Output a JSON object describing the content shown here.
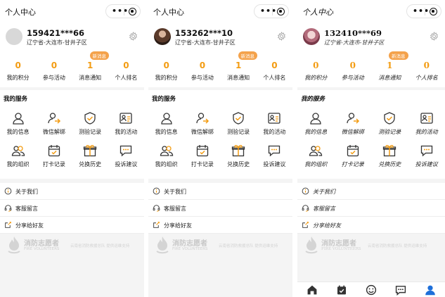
{
  "app": {
    "title": "个人中心"
  },
  "colors": {
    "accent": "#f39c12",
    "badge": "#f4a24b",
    "active_tab": "#1e6fd9"
  },
  "panels": [
    {
      "user": {
        "uid": "159421***66",
        "location": "辽宁省-大连市-甘井子区"
      },
      "stats": [
        {
          "value": "0",
          "label": "我的积分"
        },
        {
          "value": "0",
          "label": "参与活动"
        },
        {
          "value": "1",
          "label": "消息通知",
          "badge": "新消息"
        },
        {
          "value": "0",
          "label": "个人排名"
        }
      ]
    },
    {
      "user": {
        "uid": "153262***10",
        "location": "辽宁省-大连市-甘井子区"
      },
      "stats": [
        {
          "value": "0",
          "label": "我的积分"
        },
        {
          "value": "0",
          "label": "参与活动"
        },
        {
          "value": "1",
          "label": "消息通知",
          "badge": "新消息"
        },
        {
          "value": "0",
          "label": "个人排名"
        }
      ]
    },
    {
      "user": {
        "uid": "132410***69",
        "location": "辽宁省-大连市-甘井子区"
      },
      "stats": [
        {
          "value": "0",
          "label": "我的积分"
        },
        {
          "value": "0",
          "label": "参与活动"
        },
        {
          "value": "1",
          "label": "消息通知",
          "badge": "新消息"
        },
        {
          "value": "0",
          "label": "个人排名"
        }
      ]
    }
  ],
  "services": {
    "title": "我的服务",
    "items": [
      {
        "label": "我的信息",
        "icon": "user-icon"
      },
      {
        "label": "微信解绑",
        "icon": "unbind-icon"
      },
      {
        "label": "测验记录",
        "icon": "shield-check-icon"
      },
      {
        "label": "我的活动",
        "icon": "activity-icon"
      },
      {
        "label": "我的组织",
        "icon": "group-icon"
      },
      {
        "label": "打卡记录",
        "icon": "calendar-icon"
      },
      {
        "label": "兑换历史",
        "icon": "gift-icon"
      },
      {
        "label": "投诉建议",
        "icon": "chat-icon"
      }
    ]
  },
  "menu": [
    {
      "label": "关于我们",
      "icon": "info-icon"
    },
    {
      "label": "客服留言",
      "icon": "headset-icon"
    },
    {
      "label": "分享给好友",
      "icon": "share-icon"
    }
  ],
  "footer": {
    "org_name": "消防志愿者",
    "org_sub": "FIRE VOLUNTEERS",
    "support": "云南省消防救援总队 提供运维支持"
  },
  "tabbar": [
    {
      "icon": "home-icon"
    },
    {
      "icon": "checkin-icon"
    },
    {
      "icon": "smile-icon"
    },
    {
      "icon": "message-icon"
    },
    {
      "icon": "profile-icon"
    }
  ]
}
